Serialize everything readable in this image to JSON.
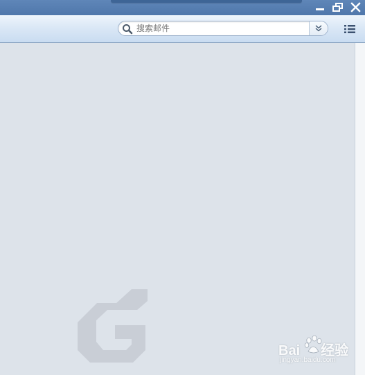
{
  "window": {
    "controls": {
      "minimize_icon": "minimize-icon",
      "restore_icon": "restore-icon",
      "close_icon": "close-icon"
    }
  },
  "toolbar": {
    "search": {
      "placeholder": "搜索邮件",
      "value": "",
      "icon": "search-icon",
      "dropdown_icon": "double-chevron-down-icon"
    },
    "menu_icon": "list-menu-icon"
  },
  "watermarks": {
    "baidu_brand": "Bai",
    "baidu_brand_suffix": "经验",
    "baidu_url": "jingyan.baidu.com"
  },
  "colors": {
    "titlebar": "#5f86b8",
    "toolbar": "#dbe8f6",
    "content_bg": "#dde3ea",
    "logo_gray": "#c9ced6"
  }
}
